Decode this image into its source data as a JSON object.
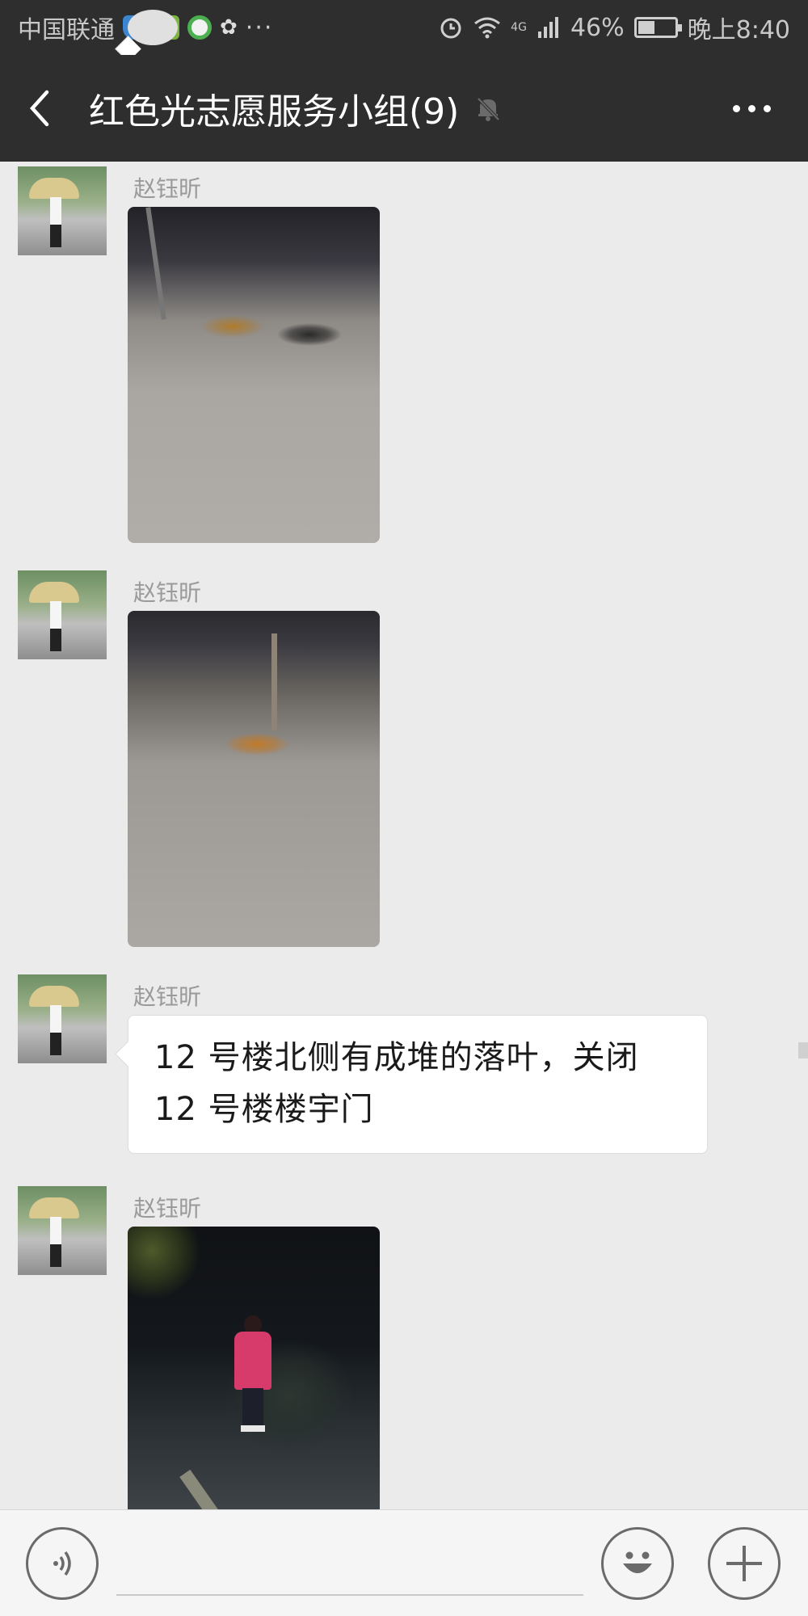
{
  "status_bar": {
    "carrier": "中国联通",
    "more_indicator": "···",
    "network": "4G",
    "battery": "46%",
    "battery_level": 0.46,
    "time": "晚上8:40",
    "icons": [
      "shield-icon",
      "message-icon",
      "app-icon",
      "browser-icon",
      "huawei-icon",
      "alarm-icon",
      "wifi-icon",
      "signal-icon",
      "battery-icon"
    ]
  },
  "header": {
    "title": "红色光志愿服务小组(9)",
    "back_icon": "chevron-left-icon",
    "mute_icon": "bell-mute-icon",
    "more_icon": "more-dots-icon"
  },
  "messages": [
    {
      "type": "image",
      "sender": "赵钰昕",
      "image": "night pavement with fallen leaves"
    },
    {
      "type": "image",
      "sender": "赵钰昕",
      "image": "pavement with pole and leaf pile"
    },
    {
      "type": "text",
      "sender": "赵钰昕",
      "lines": [
        "12 号楼北侧有成堆的落叶，关闭",
        "12 号楼楼宇门"
      ]
    },
    {
      "type": "image",
      "sender": "赵钰昕",
      "image": "girl in red vest at night"
    }
  ],
  "input_bar": {
    "voice_icon": "voice-icon",
    "emoji_icon": "emoji-icon",
    "plus_icon": "plus-icon"
  },
  "colors": {
    "header_bg": "#2e2e2e",
    "chat_bg": "#ebebeb",
    "bubble_bg": "#ffffff",
    "sender_text": "#9a9a9a"
  }
}
